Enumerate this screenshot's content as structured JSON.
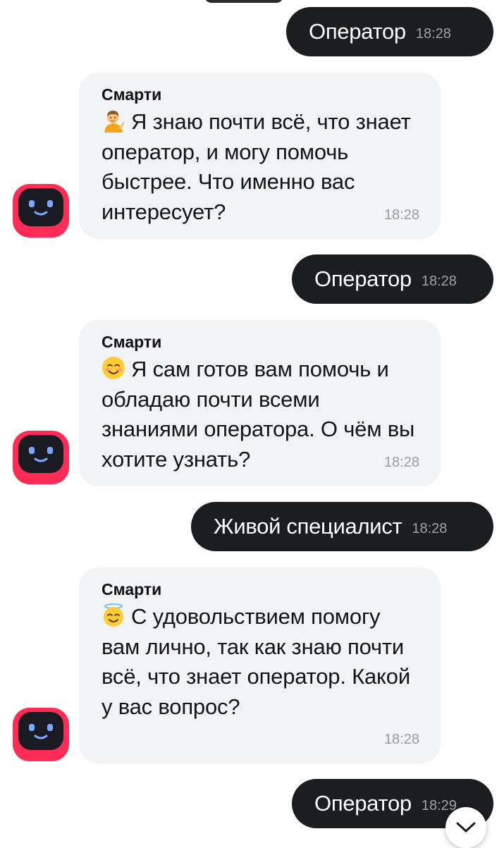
{
  "bot_name": "Смарти",
  "messages": [
    {
      "type": "out",
      "text": "Оператор",
      "time": "18:28"
    },
    {
      "type": "in",
      "sender": "Смарти",
      "emoji": "person-tipping-hand",
      "text": "Я знаю почти всё, что знает оператор, и могу помочь быстрее. Что именно вас интересует?",
      "time": "18:28"
    },
    {
      "type": "out",
      "text": "Оператор",
      "time": "18:28"
    },
    {
      "type": "in",
      "sender": "Смарти",
      "emoji": "smiling-blush",
      "text": "Я сам готов вам помочь и обладаю почти всеми знаниями оператора. О чём вы хотите узнать?",
      "time": "18:28"
    },
    {
      "type": "out",
      "text": "Живой специалист",
      "time": "18:28"
    },
    {
      "type": "in",
      "sender": "Смарти",
      "emoji": "smiling-halo",
      "text": "С удовольствием помогу вам лично, так как знаю почти всё, что знает оператор. Какой у вас вопрос?",
      "time": "18:28"
    },
    {
      "type": "out",
      "text": "Оператор",
      "time": "18:29"
    }
  ],
  "colors": {
    "outgoing_bubble": "#1c1d1f",
    "incoming_bubble": "#f2f3f5",
    "avatar_red": "#ff2d55",
    "background": "#ffffff"
  },
  "icons": {
    "avatar": "robot-face-icon",
    "scroll_down": "chevron-down-icon"
  }
}
